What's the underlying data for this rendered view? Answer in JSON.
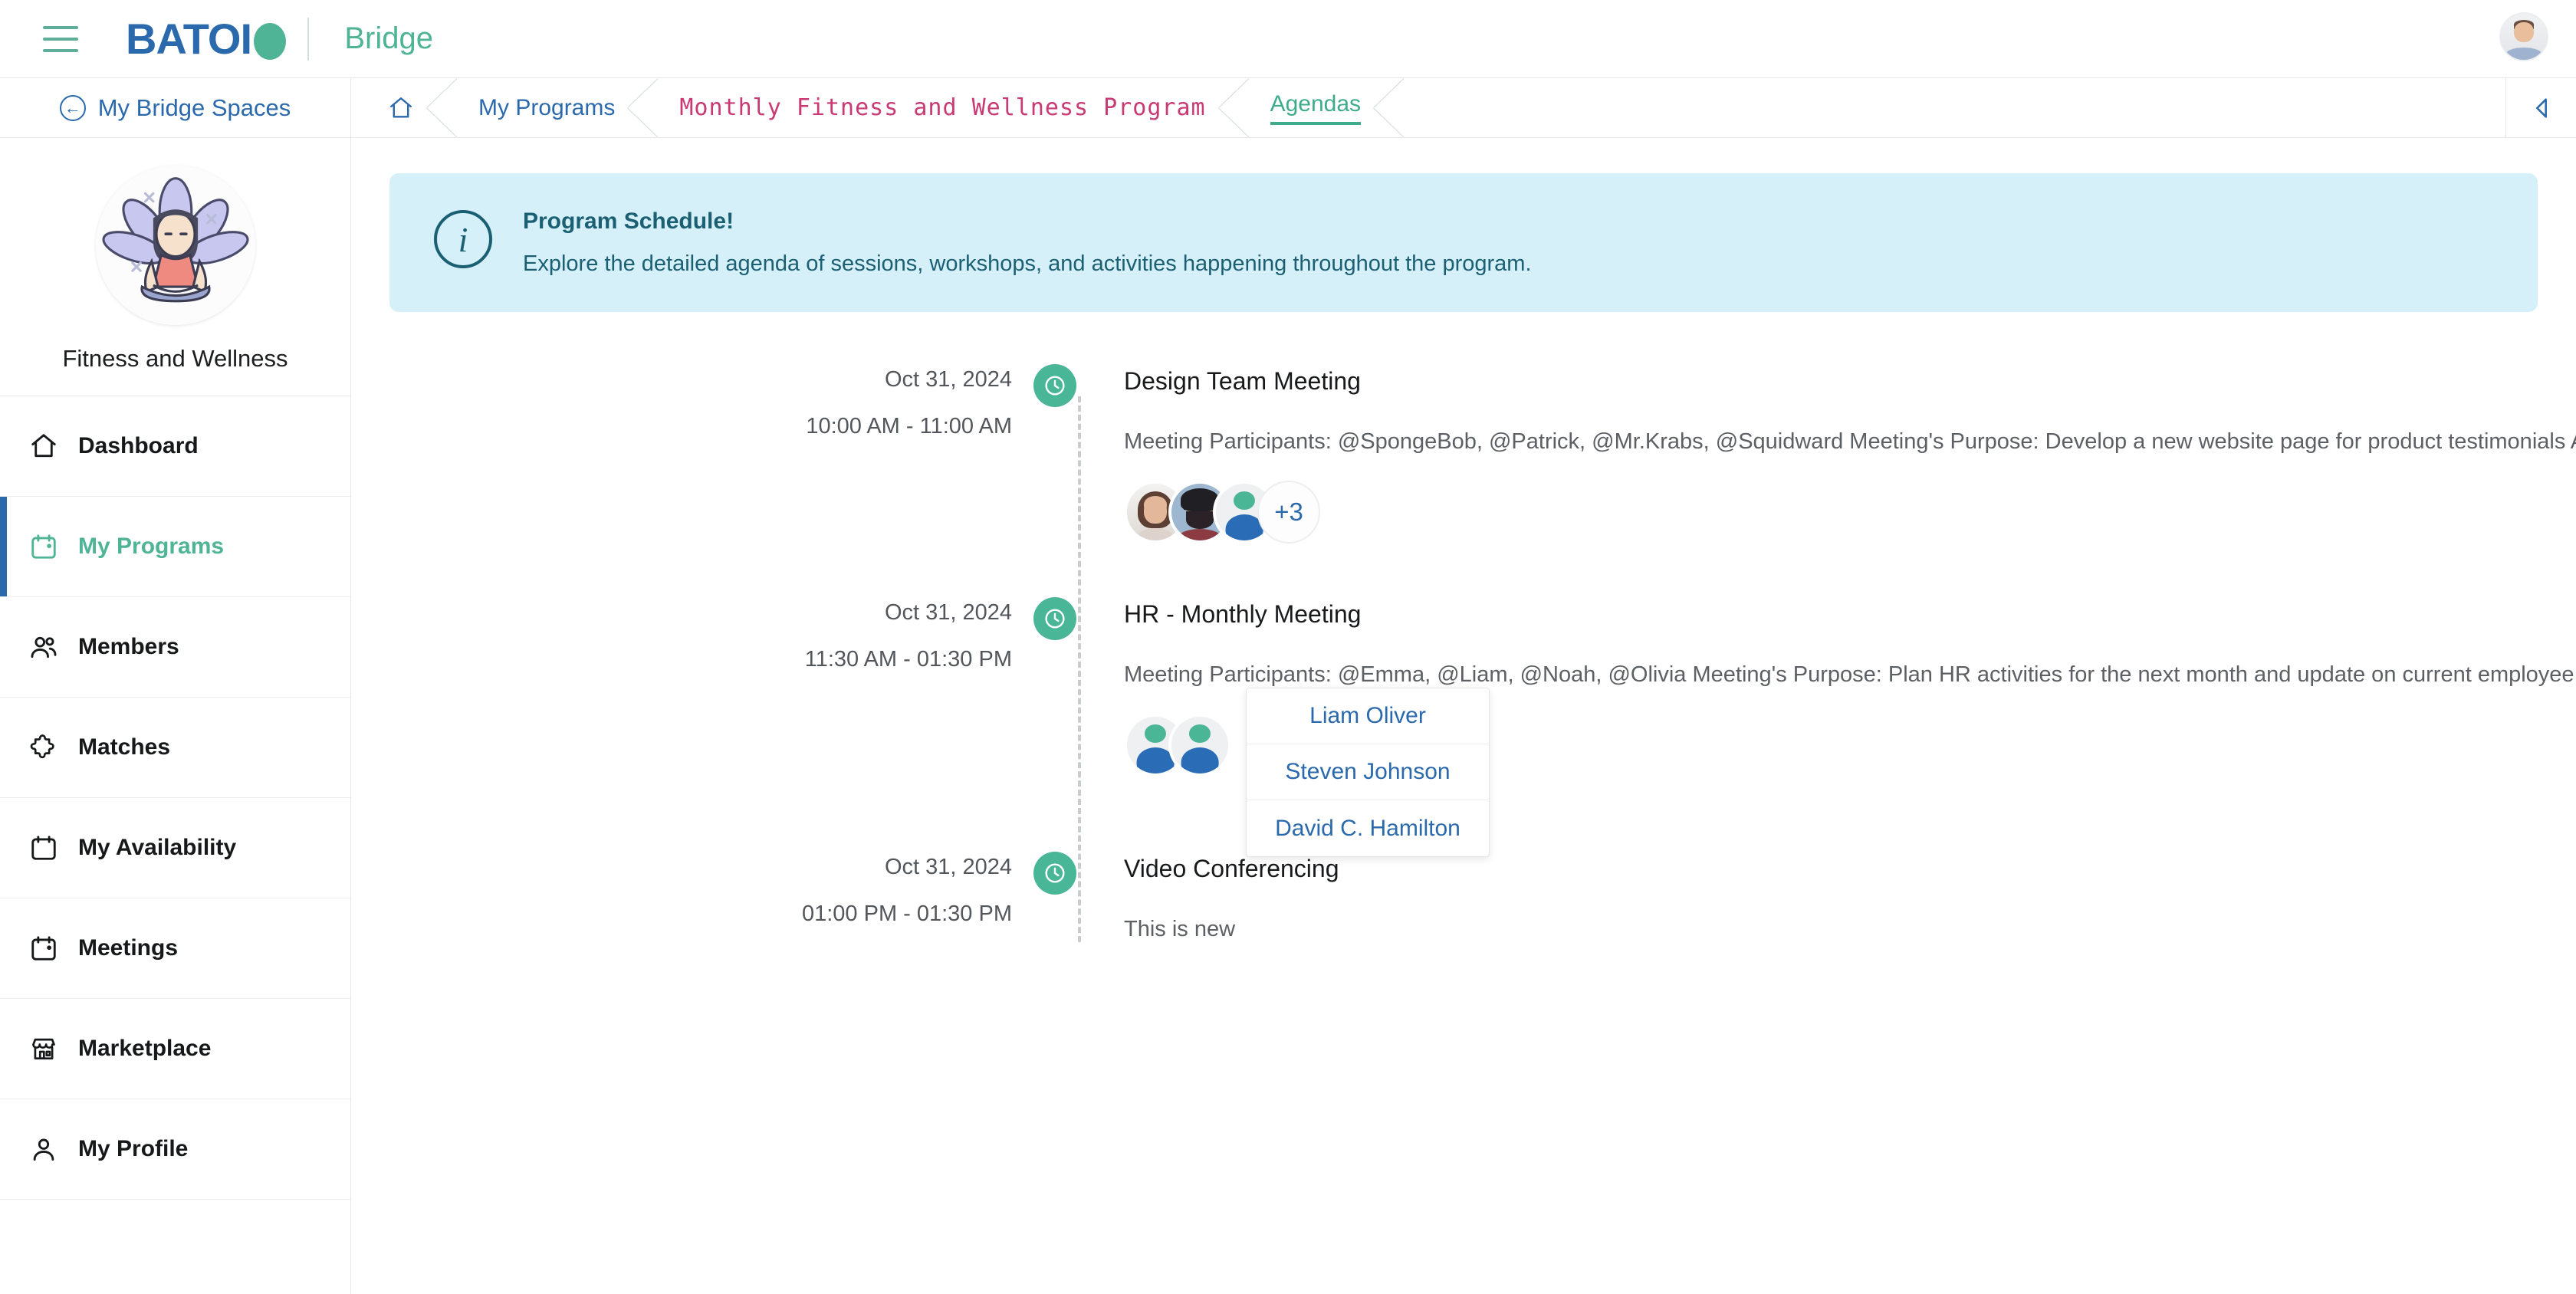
{
  "topbar": {
    "menu_icon": "hamburger-icon",
    "brand": "BATOI",
    "brand_reg": "®",
    "app_name": "Bridge",
    "user_avatar": "user-avatar"
  },
  "sidebar": {
    "back_label": "My Bridge Spaces",
    "space_name": "Fitness and Wellness",
    "space_avatar_icon": "yoga-meditation-avatar",
    "items": [
      {
        "label": "Dashboard",
        "icon": "home-icon",
        "active": false
      },
      {
        "label": "My Programs",
        "icon": "calendar-icon",
        "active": true
      },
      {
        "label": "Members",
        "icon": "users-icon",
        "active": false
      },
      {
        "label": "Matches",
        "icon": "puzzle-icon",
        "active": false
      },
      {
        "label": "My Availability",
        "icon": "calendar-icon",
        "active": false
      },
      {
        "label": "Meetings",
        "icon": "calendar-icon",
        "active": false
      },
      {
        "label": "Marketplace",
        "icon": "store-icon",
        "active": false
      },
      {
        "label": "My Profile",
        "icon": "person-icon",
        "active": false
      }
    ]
  },
  "breadcrumb": {
    "home_icon": "home-icon",
    "items": [
      {
        "label": "My Programs",
        "style": "link"
      },
      {
        "label": "Monthly Fitness and Wellness Program",
        "style": "program"
      },
      {
        "label": "Agendas",
        "style": "active"
      }
    ],
    "collapse_icon": "collapse-left-icon"
  },
  "banner": {
    "icon": "info-icon",
    "title": "Program Schedule!",
    "description": "Explore the detailed agenda of sessions, workshops, and activities happening throughout the program."
  },
  "agenda": {
    "items": [
      {
        "date": "Oct 31, 2024",
        "time": "10:00 AM - 11:00 AM",
        "title": "Design Team Meeting",
        "description": "Meeting Participants: @SpongeBob, @Patrick, @Mr.Krabs, @Squidward Meeting's Purpose: Develop a new website page for product testimonials Ag...",
        "more_label": "[ + ]",
        "avatar_count_label": "+3"
      },
      {
        "date": "Oct 31, 2024",
        "time": "11:30 AM - 01:30 PM",
        "title": "HR - Monthly Meeting",
        "description": "Meeting Participants: @Emma, @Liam, @Noah, @Olivia Meeting's Purpose: Plan HR activities for the next month and update on current employee ini...",
        "more_label": "[ + ]"
      },
      {
        "date": "Oct 31, 2024",
        "time": "01:00 PM - 01:30 PM",
        "title": "Video Conferencing",
        "description": "This is new"
      }
    ]
  },
  "participants_dropdown": {
    "names": [
      "Liam Oliver",
      "Steven Johnson",
      "David C. Hamilton"
    ]
  },
  "colors": {
    "brand_blue": "#2a69ac",
    "brand_green": "#4fb395",
    "program_pink": "#c93a74",
    "banner_bg": "#d6f0fa",
    "banner_text": "#1b5f72",
    "marker_green": "#4ab698"
  }
}
